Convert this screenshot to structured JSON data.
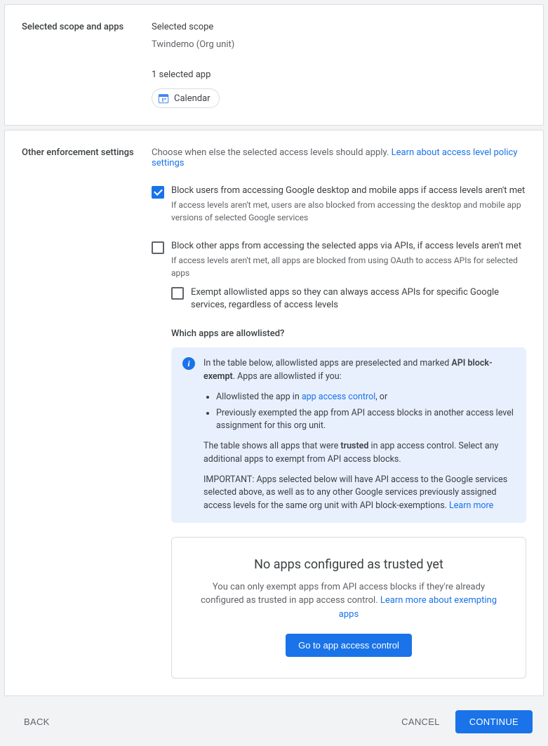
{
  "scope_card": {
    "title": "Selected scope and apps",
    "scope_label": "Selected scope",
    "scope_value": "Twindemo (Org unit)",
    "app_count_label": "1 selected app",
    "chip_label": "Calendar"
  },
  "enforcement": {
    "title": "Other enforcement settings",
    "desc_prefix": "Choose when else the selected access levels should apply. ",
    "desc_link": "Learn about access level policy settings",
    "opt1_title": "Block users from accessing Google desktop and mobile apps if access levels aren't met",
    "opt1_sub": "If access levels aren't met, users are also blocked from accessing the desktop and mobile app versions of selected Google services",
    "opt2_title": "Block other apps from accessing the selected apps via APIs, if access levels aren't met",
    "opt2_sub": "If access levels aren't met, all apps are blocked from using OAuth to access APIs for selected apps",
    "exempt_title": "Exempt allowlisted apps so they can always access APIs for specific Google services, regardless of access levels",
    "which_heading": "Which apps are allowlisted?",
    "info": {
      "p1_pre": "In the table below, allowlisted apps are preselected and marked ",
      "p1_bold": "API block-exempt",
      "p1_post": ". Apps are allowlisted if you:",
      "li1_pre": "Allowlisted the app in ",
      "li1_link": "app access control",
      "li1_post": ", or",
      "li2": "Previously exempted the app from API access blocks in another access level assignment for this org unit.",
      "p2_pre": "The table shows all apps that were ",
      "p2_bold": "trusted",
      "p2_post": " in app access control. Select any additional apps to exempt from API access blocks.",
      "p3": "IMPORTANT: Apps selected below will have API access to the Google services selected above, as well as to any other Google services previously assigned access levels for the same org unit with API block-exemptions. ",
      "p3_link": "Learn more"
    },
    "empty": {
      "title": "No apps configured as trusted yet",
      "sub_pre": "You can only exempt apps from API access blocks if they're already configured as trusted in app access control. ",
      "sub_link": "Learn more about exempting apps",
      "button": "Go to app access control"
    }
  },
  "footer": {
    "back": "BACK",
    "cancel": "CANCEL",
    "continue": "CONTINUE"
  }
}
